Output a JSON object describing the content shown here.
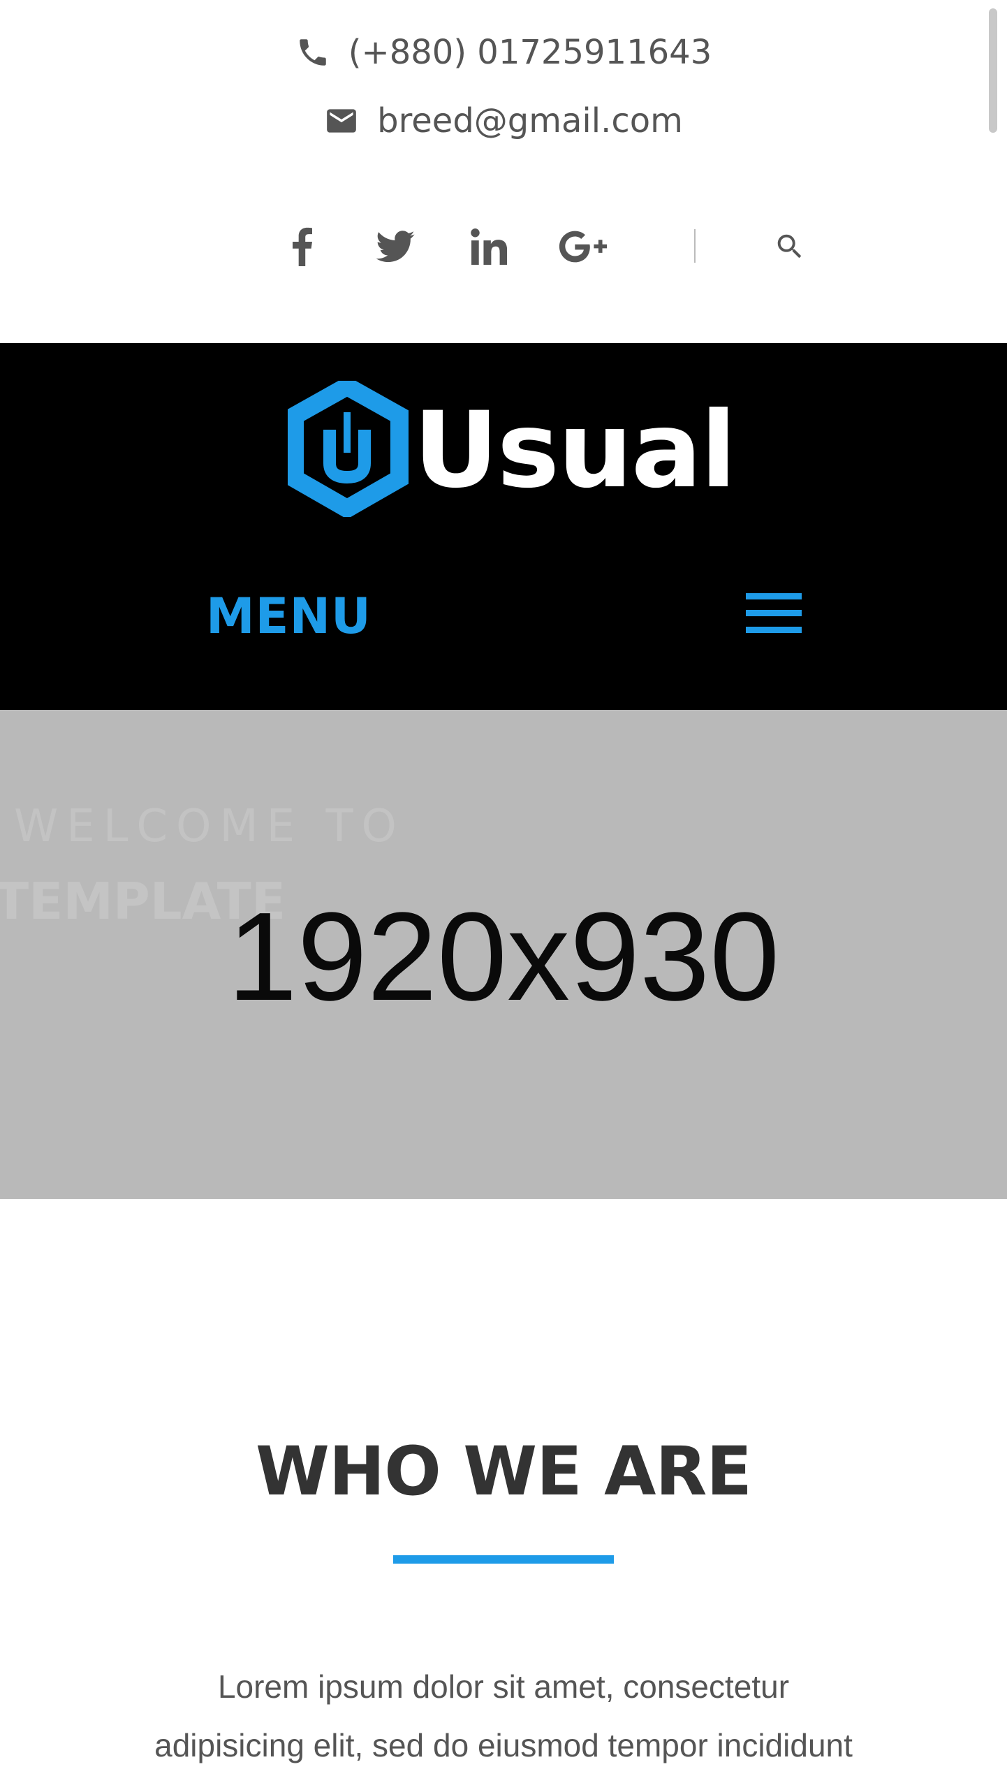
{
  "topbar": {
    "phone": "(+880) 01725911643",
    "email": "breed@gmail.com",
    "social": [
      {
        "name": "facebook-icon"
      },
      {
        "name": "twitter-icon"
      },
      {
        "name": "linkedin-icon"
      },
      {
        "name": "google-plus-icon"
      }
    ],
    "search_icon": "search-icon"
  },
  "header": {
    "logo_text": "Usual",
    "menu_label": "MENU",
    "accent_color": "#1e9be8"
  },
  "hero": {
    "welcome_text": "WELCOME TO",
    "template_text": "TEMPLATE",
    "placeholder_size": "1920x930"
  },
  "about": {
    "title": "WHO WE ARE",
    "text": "Lorem ipsum dolor sit amet, consectetur adipisicing elit, sed do eiusmod tempor incididunt ut labore et dolore magna aliqua."
  }
}
